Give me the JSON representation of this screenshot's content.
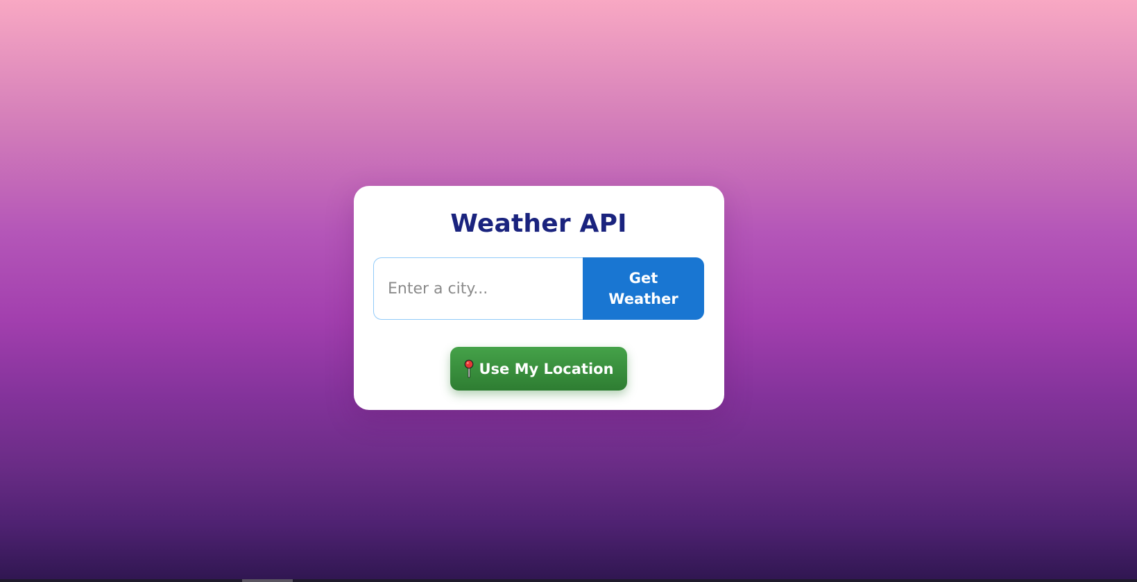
{
  "app": {
    "title": "Weather API"
  },
  "search": {
    "placeholder": "Enter a city...",
    "value": ""
  },
  "buttons": {
    "get_weather_label": "Get Weather",
    "location_label": "Use My Location",
    "location_icon": "round-pushpin-icon"
  },
  "colors": {
    "title": "#1a237e",
    "get_weather_bg": "#1976d2",
    "location_bg": "#2e7d32",
    "input_border": "#90caf9"
  }
}
